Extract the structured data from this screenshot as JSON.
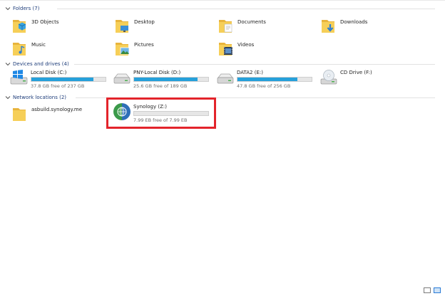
{
  "groups": {
    "folders": {
      "title": "Folders (7)"
    },
    "devices": {
      "title": "Devices and drives (4)"
    },
    "network": {
      "title": "Network locations (2)"
    }
  },
  "folders": [
    {
      "label": "3D Objects",
      "icon": "3d-objects-folder-icon"
    },
    {
      "label": "Desktop",
      "icon": "desktop-folder-icon"
    },
    {
      "label": "Documents",
      "icon": "documents-folder-icon"
    },
    {
      "label": "Downloads",
      "icon": "downloads-folder-icon"
    },
    {
      "label": "Music",
      "icon": "music-folder-icon"
    },
    {
      "label": "Pictures",
      "icon": "pictures-folder-icon"
    },
    {
      "label": "Videos",
      "icon": "videos-folder-icon"
    }
  ],
  "drives": [
    {
      "name": "Local Disk (C:)",
      "free": "37.8 GB free of 237 GB",
      "used_fraction": 0.84
    },
    {
      "name": "PNY-Local Disk (D:)",
      "free": "25.6 GB free of 189 GB",
      "used_fraction": 0.86
    },
    {
      "name": "DATA2 (E:)",
      "free": "47.8 GB free of 256 GB",
      "used_fraction": 0.81
    },
    {
      "name": "CD Drive (F:)",
      "free": "",
      "used_fraction": null
    }
  ],
  "network": [
    {
      "label": "asbuild.synology.me"
    },
    {
      "name": "Synology (Z:)",
      "free": "7.99 EB free of 7.99 EB",
      "used_fraction": 0.0
    }
  ],
  "colors": {
    "accent": "#26a0da",
    "highlight": "#e3242b",
    "header_text": "#1e3d7a"
  }
}
